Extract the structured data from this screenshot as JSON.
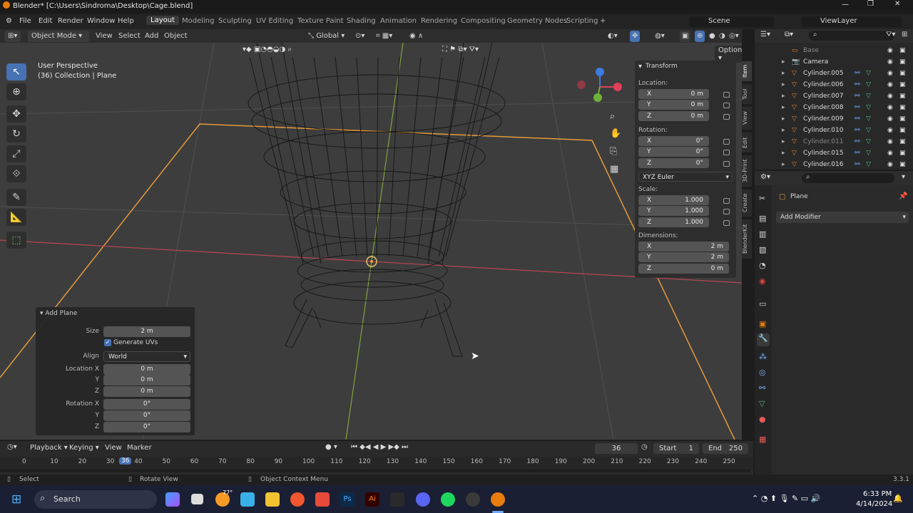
{
  "title": "Blender* [C:\\Users\\Sindroma\\Desktop\\Cage.blend]",
  "menu": [
    "File",
    "Edit",
    "Render",
    "Window",
    "Help"
  ],
  "workspaces": [
    "Layout",
    "Modeling",
    "Sculpting",
    "UV Editing",
    "Texture Paint",
    "Shading",
    "Animation",
    "Rendering",
    "Compositing",
    "Geometry Nodes",
    "Scripting"
  ],
  "scene": "Scene",
  "view_layer": "ViewLayer",
  "header": {
    "mode": "Object Mode",
    "view": "View",
    "select": "Select",
    "add": "Add",
    "object": "Object",
    "orientation": "Global",
    "options": "Options"
  },
  "overlay": {
    "line1": "User Perspective",
    "line2": "(36) Collection | Plane"
  },
  "npanel": {
    "title": "Transform",
    "location": "Location:",
    "rotation": "Rotation:",
    "scale": "Scale:",
    "dimensions": "Dimensions:",
    "euler": "XYZ Euler",
    "loc": [
      {
        "a": "X",
        "v": "0 m"
      },
      {
        "a": "Y",
        "v": "0 m"
      },
      {
        "a": "Z",
        "v": "0 m"
      }
    ],
    "rot": [
      {
        "a": "X",
        "v": "0°"
      },
      {
        "a": "Y",
        "v": "0°"
      },
      {
        "a": "Z",
        "v": "0°"
      }
    ],
    "scl": [
      {
        "a": "X",
        "v": "1.000"
      },
      {
        "a": "Y",
        "v": "1.000"
      },
      {
        "a": "Z",
        "v": "1.000"
      }
    ],
    "dim": [
      {
        "a": "X",
        "v": "2 m"
      },
      {
        "a": "Y",
        "v": "2 m"
      },
      {
        "a": "Z",
        "v": "0 m"
      }
    ]
  },
  "vtabs": [
    "Item",
    "Tool",
    "View",
    "Edit",
    "3D-Print",
    "Create",
    "BlenderKit"
  ],
  "outliner": [
    "Base",
    "Camera",
    "Cylinder.005",
    "Cylinder.006",
    "Cylinder.007",
    "Cylinder.008",
    "Cylinder.009",
    "Cylinder.010",
    "Cylinder.011",
    "Cylinder.015",
    "Cylinder.016"
  ],
  "props": {
    "object": "Plane",
    "add_modifier": "Add Modifier"
  },
  "addplane": {
    "title": "Add Plane",
    "size_l": "Size",
    "size": "2 m",
    "gen": "Generate UVs",
    "align_l": "Align",
    "align": "World",
    "locx_l": "Location X",
    "y_l": "Y",
    "z_l": "Z",
    "rotx_l": "Rotation X",
    "loc": [
      "0 m",
      "0 m",
      "0 m"
    ],
    "rot": [
      "0°",
      "0°",
      "0°"
    ]
  },
  "timeline": {
    "playback": "Playback",
    "keying": "Keying",
    "view": "View",
    "marker": "Marker",
    "frame": "36",
    "start_l": "Start",
    "start": "1",
    "end_l": "End",
    "end": "250",
    "ticks": [
      "0",
      "10",
      "20",
      "30",
      "40",
      "50",
      "60",
      "70",
      "80",
      "90",
      "100",
      "110",
      "120",
      "130",
      "140",
      "150",
      "160",
      "170",
      "180",
      "190",
      "200",
      "210",
      "220",
      "230",
      "240",
      "250"
    ]
  },
  "status": {
    "select": "Select",
    "rotate": "Rotate View",
    "ctx": "Object Context Menu",
    "version": "3.3.1"
  },
  "taskbar": {
    "search": "Search",
    "time": "6:33 PM",
    "date": "4/14/2024",
    "temp": "77°"
  }
}
